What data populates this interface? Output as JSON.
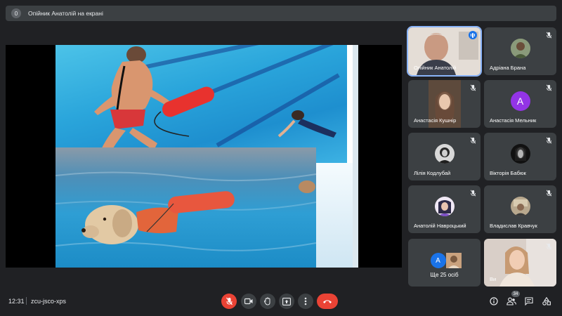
{
  "banner": {
    "badge": "0",
    "text": "Опійник Анатолій на екрані"
  },
  "participants": [
    {
      "name": "Опійник Анатолій",
      "type": "camera",
      "speaking": true
    },
    {
      "name": "Адріана Брана",
      "type": "photo",
      "muted": true
    },
    {
      "name": "Анастасія Кушнір",
      "type": "camera",
      "muted": true
    },
    {
      "name": "Анастасія Мельник",
      "type": "letter",
      "letter": "А",
      "color": "#9334e6",
      "muted": true
    },
    {
      "name": "Лілія Кодлубай",
      "type": "photo",
      "muted": true
    },
    {
      "name": "Вікторія Бабюк",
      "type": "photo",
      "muted": true
    },
    {
      "name": "Анатолій Навроцький",
      "type": "photo",
      "muted": true
    },
    {
      "name": "Владислав Кравчук",
      "type": "photo",
      "muted": true
    },
    {
      "name": "Ви",
      "type": "camera",
      "muted": true
    }
  ],
  "others": {
    "label": "Ще 25 осіб",
    "avatar_letter": "А",
    "avatar_color": "#1a73e8"
  },
  "footer": {
    "time": "12:31",
    "meeting_code": "zcu-jsco-xps",
    "participant_count": "34"
  },
  "controls": [
    "mic-off",
    "camera",
    "raise-hand",
    "present",
    "more-options",
    "leave-call"
  ],
  "right_controls": [
    "info",
    "people",
    "chat",
    "activities"
  ],
  "colors": {
    "background": "#202124",
    "tile": "#3c4043",
    "accent": "#8ab4f8",
    "danger": "#ea4335"
  }
}
